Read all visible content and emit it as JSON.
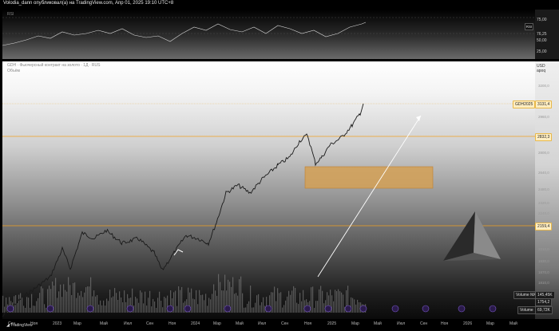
{
  "header": {
    "title": "Volodia_dann опубликовал(а) на TradingView.com, Апр 01, 2025 19:10 UTC+8"
  },
  "rsi": {
    "label": "RSI",
    "value": "76,25",
    "levels": [
      "75,00",
      "50,00",
      "25,00"
    ],
    "value_badge_color": "#cc44cc"
  },
  "main": {
    "legend_line1": "GDH · Фьючерсный контракт на золото · 1Д · RUS",
    "legend_line2": "Объём",
    "currency": "USD",
    "scale_mode": "apoq",
    "price_ticks": [
      "3200,0",
      "2960,0",
      "2800,0",
      "2640,0",
      "2480,0",
      "2320,0",
      "2240,0",
      "2090,0",
      "2010,0",
      "1930,0",
      "1870,0",
      "1810,0"
    ],
    "badges": {
      "symbol_name": "GDH2025",
      "last_price": "3131,4",
      "level_high": "2832,3",
      "level_low": "2159,4",
      "volume_label": "Volume MA",
      "volume_ma": "145,45K",
      "price_low": "1754,2",
      "volume_label2": "Volume",
      "volume": "69,72K"
    },
    "accent_colors": {
      "level_line": "#f0a020",
      "zone": "#d4a055",
      "arrow": "#ffffff"
    }
  },
  "time_axis": [
    "Сен",
    "Ноя",
    "2023",
    "Мар",
    "Май",
    "Июл",
    "Сен",
    "Ноя",
    "2024",
    "Мар",
    "Май",
    "Июл",
    "Сен",
    "Ноя",
    "2025",
    "Мар",
    "Май",
    "Июл",
    "Сен",
    "Ноя",
    "2026",
    "Мар",
    "Май"
  ],
  "footer": {
    "brand": "TradingView"
  }
}
